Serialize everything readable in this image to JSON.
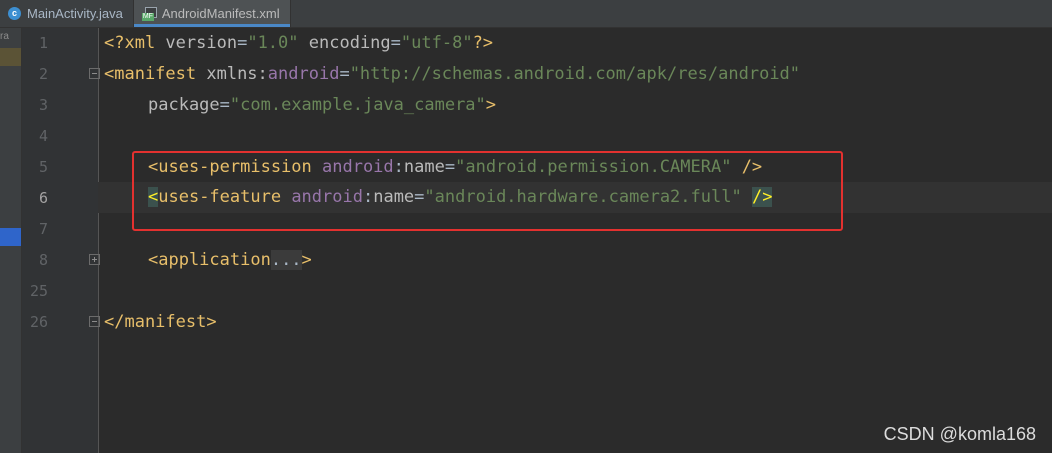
{
  "tabs": [
    {
      "label": "MainActivity.java",
      "icon": "java-class-icon",
      "active": false
    },
    {
      "label": "AndroidManifest.xml",
      "icon": "manifest-file-icon",
      "active": true
    }
  ],
  "left_strip_text": "ra",
  "line_numbers": [
    "1",
    "2",
    "3",
    "4",
    "5",
    "6",
    "7",
    "8",
    "25",
    "26"
  ],
  "code": {
    "l1": {
      "open": "<?xml ",
      "a1": "version",
      "eq1": "=",
      "v1": "\"1.0\"",
      "sp": " ",
      "a2": "encoding",
      "eq2": "=",
      "v2": "\"utf-8\"",
      "close": "?>"
    },
    "l2": {
      "open": "<manifest ",
      "attr": "xmlns:",
      "ns": "android",
      "eq": "=",
      "val": "\"http://schemas.android.com/apk/res/android\""
    },
    "l3": {
      "attr": "package",
      "eq": "=",
      "val": "\"com.example.java_camera\"",
      "close": ">"
    },
    "l5": {
      "open": "<uses-permission ",
      "ns": "android",
      "colon": ":",
      "attr": "name",
      "eq": "=",
      "val": "\"android.permission.CAMERA\"",
      "close": " />"
    },
    "l6": {
      "lt": "<",
      "tag": "uses-feature ",
      "ns": "android",
      "colon": ":",
      "attr": "name",
      "eq": "=",
      "val": "\"android.hardware.camera2.full\"",
      "sp": " ",
      "close": "/>"
    },
    "l8": {
      "open": "<application",
      "folded": "...",
      "close": ">"
    },
    "l26": {
      "close": "</manifest>"
    }
  },
  "watermark": "CSDN @komla168",
  "colors": {
    "highlight_box": "#e3312f",
    "tag": "#e8bf6a",
    "value": "#6a8759",
    "namespace": "#9876aa"
  }
}
